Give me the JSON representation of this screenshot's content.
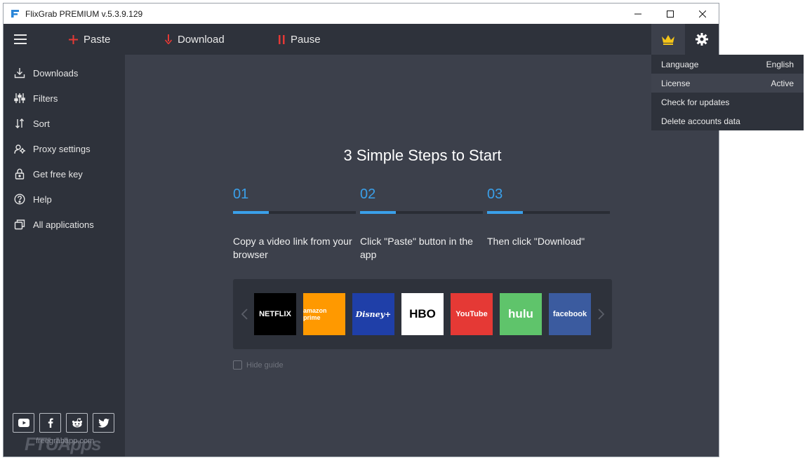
{
  "window": {
    "title": "FlixGrab PREMIUM  v.5.3.9.129"
  },
  "toolbar": {
    "paste_label": "Paste",
    "download_label": "Download",
    "pause_label": "Pause"
  },
  "sidebar": {
    "items": [
      {
        "label": "Downloads",
        "icon": "download-icon"
      },
      {
        "label": "Filters",
        "icon": "filters-icon"
      },
      {
        "label": "Sort",
        "icon": "sort-icon"
      },
      {
        "label": "Proxy settings",
        "icon": "proxy-icon"
      },
      {
        "label": "Get free key",
        "icon": "lock-icon"
      },
      {
        "label": "Help",
        "icon": "help-icon"
      },
      {
        "label": "All applications",
        "icon": "applications-icon"
      }
    ],
    "watermark": "FTUApps",
    "watermark_sub": "freegrabapp.com"
  },
  "main": {
    "headline": "3 Simple Steps to Start",
    "steps": [
      {
        "number": "01",
        "text": "Copy a video link from your browser",
        "progress": 0.29
      },
      {
        "number": "02",
        "text": "Click \"Paste\" button in the app",
        "progress": 0.29
      },
      {
        "number": "03",
        "text": "Then click \"Download\"",
        "progress": 0.29
      }
    ],
    "services": [
      {
        "label": "NETFLIX",
        "bg": "#000000",
        "fg": "#ffffff"
      },
      {
        "label": "amazon prime",
        "bg": "#ff9900",
        "fg": "#ffffff"
      },
      {
        "label": "Disney+",
        "bg": "#1f3fa8",
        "fg": "#ffffff"
      },
      {
        "label": "HBO",
        "bg": "#ffffff",
        "fg": "#000000"
      },
      {
        "label": "YouTube",
        "bg": "#e53935",
        "fg": "#ffffff"
      },
      {
        "label": "hulu",
        "bg": "#5fc46b",
        "fg": "#ffffff"
      },
      {
        "label": "facebook",
        "bg": "#3b5b9f",
        "fg": "#ffffff"
      }
    ],
    "hide_guide_label": "Hide guide"
  },
  "dropdown": {
    "items": [
      {
        "label": "Language",
        "value": "English"
      },
      {
        "label": "License",
        "value": "Active"
      },
      {
        "label": "Check for updates",
        "value": ""
      },
      {
        "label": "Delete accounts data",
        "value": ""
      }
    ]
  },
  "colors": {
    "accent": "#3aa0ea",
    "toolbar_red": "#e53935",
    "crown": "#f5c518"
  }
}
